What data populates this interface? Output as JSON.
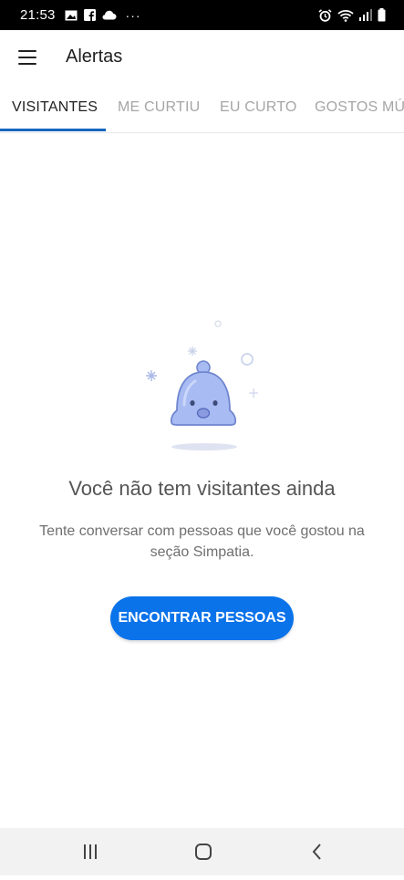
{
  "status_bar": {
    "time": "21:53",
    "dots": "···",
    "icons": [
      "image-icon",
      "facebook-icon",
      "cloud-icon",
      "alarm-icon",
      "wifi-icon",
      "signal-icon",
      "battery-icon"
    ]
  },
  "app_bar": {
    "title": "Alertas",
    "menu_icon": "hamburger-menu-icon"
  },
  "tabs": [
    {
      "label": "VISITANTES",
      "active": true
    },
    {
      "label": "ME CURTIU",
      "active": false
    },
    {
      "label": "EU CURTO",
      "active": false
    },
    {
      "label": "GOSTOS MÚTUOS",
      "active": false
    }
  ],
  "empty_state": {
    "illustration_icon": "bell-icon",
    "title": "Você não tem visitantes ainda",
    "subtitle": "Tente conversar com pessoas que você gostou na seção Simpatia.",
    "button_label": "ENCONTRAR PESSOAS"
  },
  "nav_bar": {
    "buttons": [
      "recent-apps-icon",
      "home-icon",
      "back-icon"
    ]
  },
  "colors": {
    "accent": "#0a73ea",
    "tab_indicator": "#1565c0",
    "bell": "#a8bbf2"
  }
}
